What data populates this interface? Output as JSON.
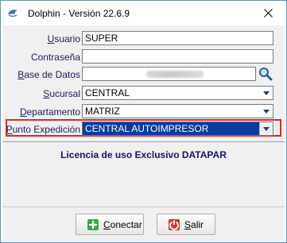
{
  "window": {
    "title": "Dolphin - Versión 22.6.9",
    "colors": {
      "accent": "#0a3c9e",
      "highlight_border": "#e0262a",
      "label_text": "#1b1b5e",
      "license_text": "#14146e"
    }
  },
  "form": {
    "usuario": {
      "label_u": "U",
      "label_rest": "suario",
      "value": "SUPER"
    },
    "contrasena": {
      "label_u": "",
      "label_rest": "Contraseña",
      "value": ""
    },
    "base_datos": {
      "label_u": "B",
      "label_rest": "ase de Datos",
      "value": ""
    },
    "sucursal": {
      "label_u": "S",
      "label_rest": "ucursal",
      "value": "CENTRAL"
    },
    "departamento": {
      "label_u": "D",
      "label_rest": "epartamento",
      "value": "MATRIZ"
    },
    "punto_expedicion": {
      "label_u": "P",
      "label_rest": "unto Expedición",
      "value": "CENTRAL AUTOIMPRESOR"
    }
  },
  "license": {
    "text": "Licencia de uso Exclusivo DATAPAR"
  },
  "buttons": {
    "conectar": {
      "label_u": "C",
      "label_rest": "onectar"
    },
    "salir": {
      "label_u": "S",
      "label_rest": "alir"
    }
  },
  "icons": {
    "app": "dolphin-icon",
    "close": "close-icon",
    "search": "magnifier-icon",
    "dropdown": "chevron-down-icon",
    "conectar": "connect-icon",
    "salir": "exit-icon"
  }
}
